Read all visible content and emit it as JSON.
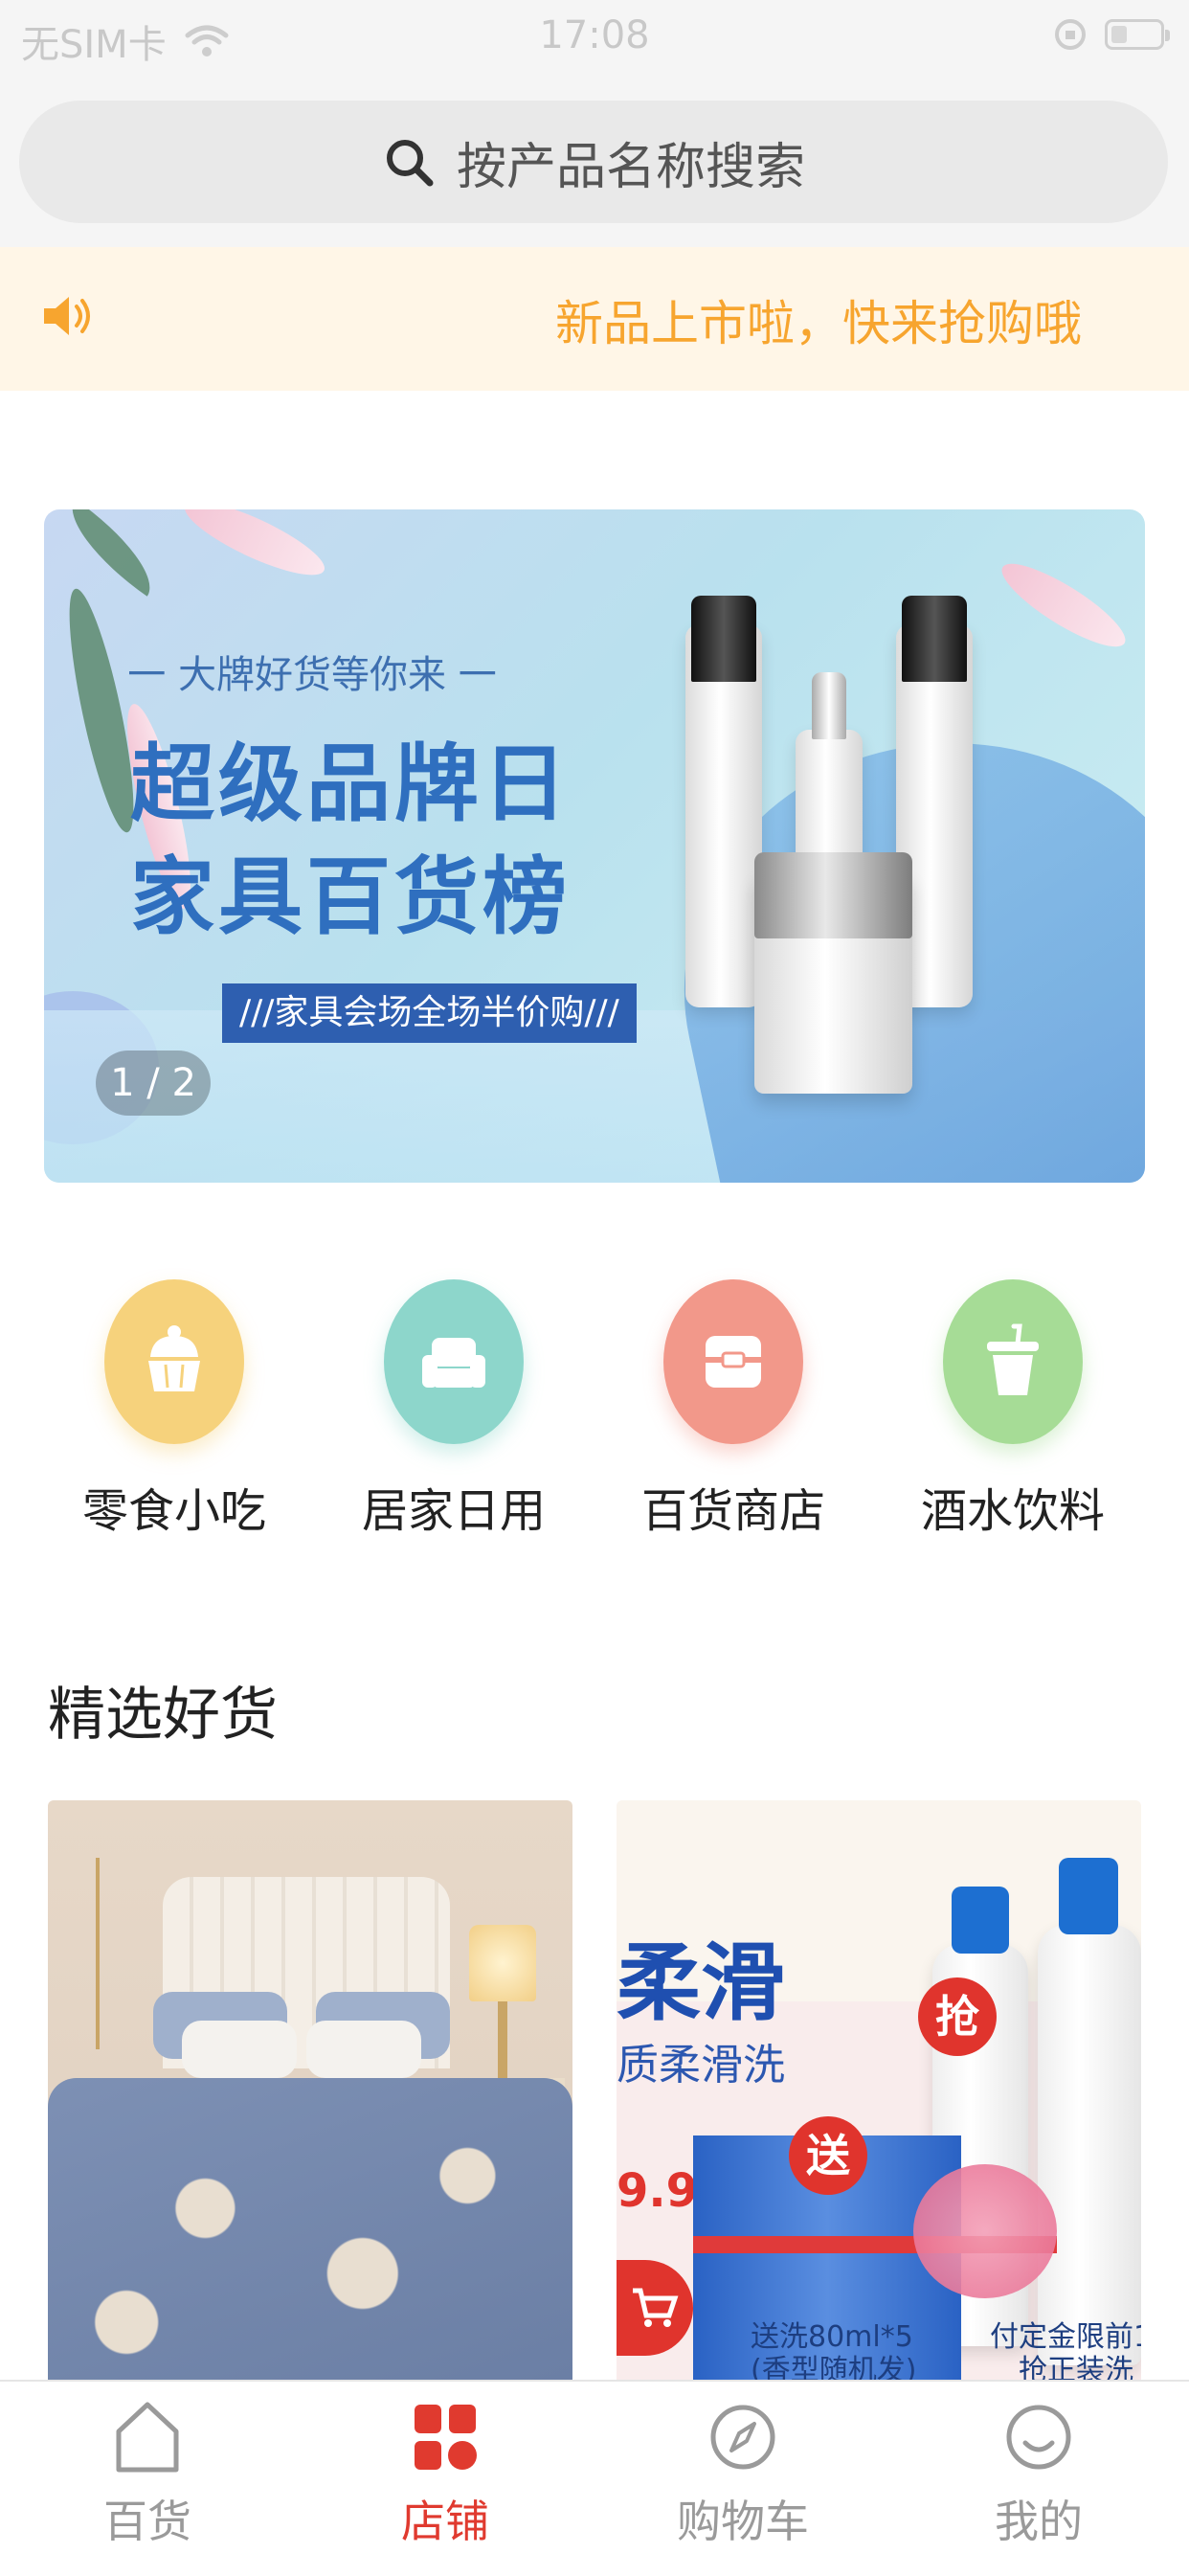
{
  "status_bar": {
    "carrier": "无SIM卡",
    "time": "17:08"
  },
  "search": {
    "placeholder": "按产品名称搜索"
  },
  "notice": {
    "text": "新品上市啦，快来抢购哦",
    "color": "#f7a52f"
  },
  "banner": {
    "subtitle": "一 大牌好货等你来 一",
    "title_line1": "超级品牌日",
    "title_line2": "家具百货榜",
    "tag": "///家具会场全场半价购///",
    "pager": "1 / 2"
  },
  "categories": [
    {
      "label": "零食小吃",
      "icon": "cake-icon",
      "color": "#f6d27c"
    },
    {
      "label": "居家日用",
      "icon": "sofa-icon",
      "color": "#8dd6cb"
    },
    {
      "label": "百货商店",
      "icon": "store-icon",
      "color": "#f2988a"
    },
    {
      "label": "酒水饮料",
      "icon": "drink-cup-icon",
      "color": "#a6dc96"
    }
  ],
  "section": {
    "title": "精选好货"
  },
  "products": [
    {
      "name": "bedding-product"
    },
    {
      "name": "shampoo-product",
      "text_big": "柔滑",
      "text_sub": "质柔滑洗",
      "badge_grab": "抢",
      "badge_gift": "送",
      "price_partial": "9.9",
      "gift_note": "送洗80ml*5",
      "gift_note2": "(香型随机发)",
      "deposit_note": "付定金限前1",
      "deposit_note2": "抢正装洗"
    }
  ],
  "tabbar": {
    "items": [
      {
        "label": "百货",
        "icon": "house-icon",
        "active": false
      },
      {
        "label": "店铺",
        "icon": "grid-icon",
        "active": true
      },
      {
        "label": "购物车",
        "icon": "compass-icon",
        "active": false
      },
      {
        "label": "我的",
        "icon": "smile-icon",
        "active": false
      }
    ],
    "active_color": "#e03a2f",
    "inactive_color": "#9a9a9a"
  }
}
